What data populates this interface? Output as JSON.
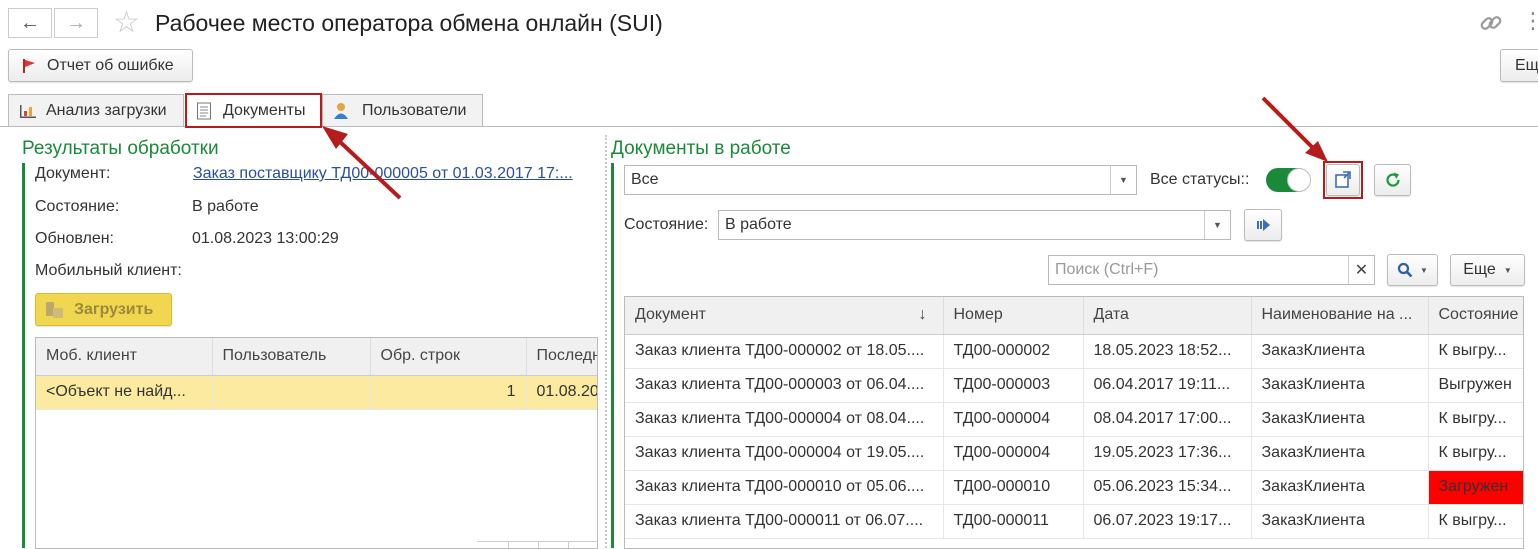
{
  "window": {
    "title": "Рабочее место оператора обмена онлайн (SUI)",
    "report_error_label": "Отчет об ошибке",
    "more_label": "Ещ"
  },
  "tabs": [
    {
      "label": "Анализ загрузки"
    },
    {
      "label": "Документы"
    },
    {
      "label": "Пользователи"
    }
  ],
  "left": {
    "section_title": "Результаты обработки",
    "document_label": "Документ:",
    "document_value": "Заказ поставщику ТД00-000005 от 01.03.2017 17:...",
    "state_label": "Состояние:",
    "state_value": "В работе",
    "updated_label": "Обновлен:",
    "updated_value": "01.08.2023 13:00:29",
    "mobile_client_label": "Мобильный клиент:",
    "load_button": "Загрузить",
    "table": {
      "columns": [
        "Моб. клиент",
        "Пользователь",
        "Обр. строк",
        "Последн"
      ],
      "rows": [
        [
          "<Объект не найд...",
          "",
          "1",
          "01.08.20"
        ]
      ]
    }
  },
  "right": {
    "section_title": "Документы в работе",
    "filter_value": "Все",
    "all_statuses_label": "Все статусы::",
    "state_label": "Состояние:",
    "state_value": "В работе",
    "search_placeholder": "Поиск (Ctrl+F)",
    "more_label": "Еще",
    "table": {
      "columns": [
        "Документ",
        "Номер",
        "Дата",
        "Наименование на ...",
        "Состояние"
      ],
      "rows": [
        [
          "Заказ клиента ТД00-000002 от 18.05....",
          "ТД00-000002",
          "18.05.2023 18:52...",
          "ЗаказКлиента",
          "К выгру..."
        ],
        [
          "Заказ клиента ТД00-000003 от 06.04....",
          "ТД00-000003",
          "06.04.2017 19:11...",
          "ЗаказКлиента",
          "Выгружен"
        ],
        [
          "Заказ клиента ТД00-000004 от 08.04....",
          "ТД00-000004",
          "08.04.2017 17:00...",
          "ЗаказКлиента",
          "К выгру..."
        ],
        [
          "Заказ клиента ТД00-000004 от 19.05....",
          "ТД00-000004",
          "19.05.2023 17:36...",
          "ЗаказКлиента",
          "К выгру..."
        ],
        [
          "Заказ клиента ТД00-000010 от 05.06....",
          "ТД00-000010",
          "05.06.2023 15:34...",
          "ЗаказКлиента",
          "Загружен"
        ],
        [
          "Заказ клиента ТД00-000011 от 06.07....",
          "ТД00-000011",
          "06.07.2023 19:17...",
          "ЗаказКлиента",
          "К выгру..."
        ]
      ]
    }
  },
  "colors": {
    "accent_green": "#1a8a3a",
    "highlight_red": "#ff0000",
    "annotation_red": "#b71c1c",
    "selected_row": "#fbeaa0"
  }
}
